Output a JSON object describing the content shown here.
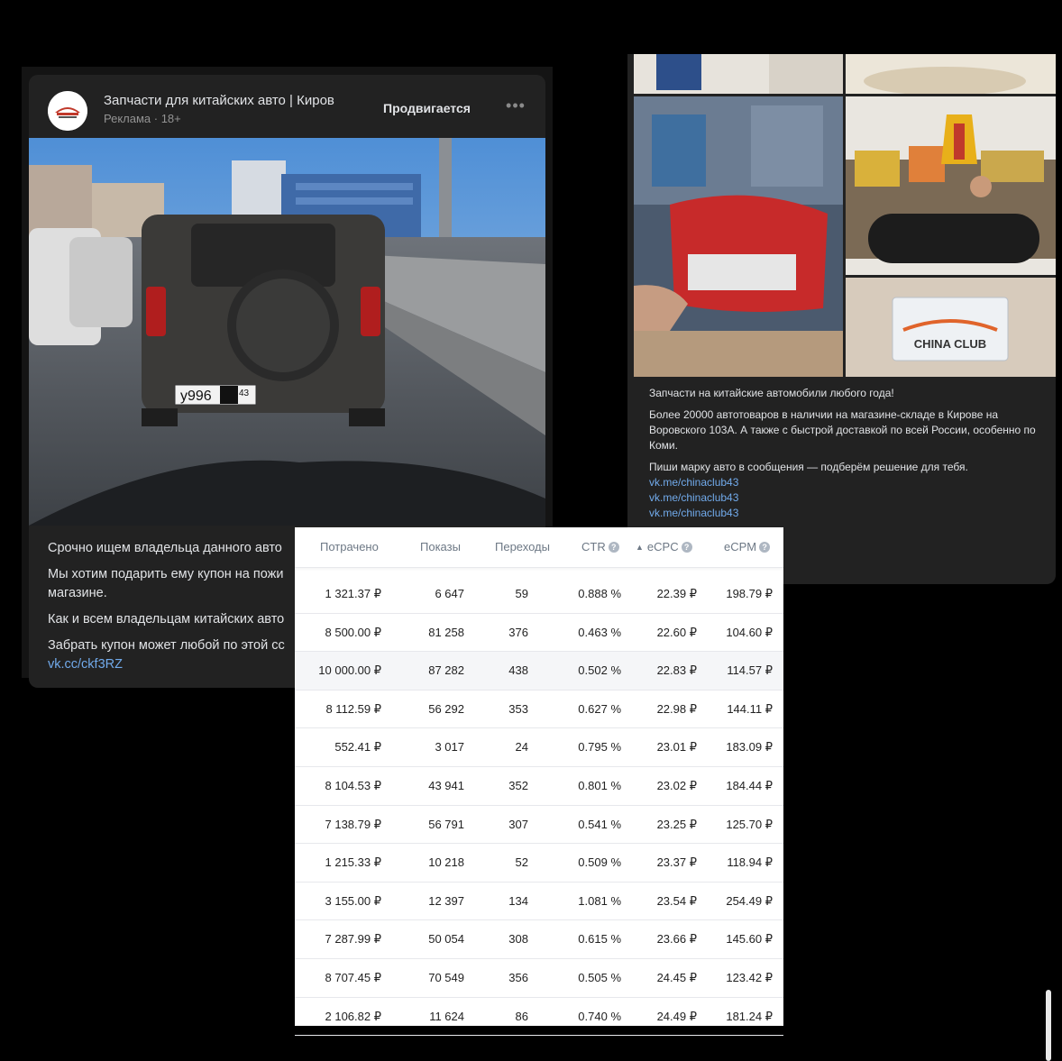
{
  "left_post": {
    "community_name": "Запчасти для китайских авто | Киров",
    "meta": "Реклама · 18+",
    "promo_label": "Продвигается",
    "more": "•••",
    "plate": "у996",
    "plate_region": "43",
    "paragraphs": [
      "Срочно ищем владельца данного авто",
      "Мы хотим подарить ему купон на пожи",
      "магазине.",
      "Как и всем владельцам китайских авто",
      "Забрать купон может любой по этой сс"
    ],
    "link": "vk.cc/ckf3RZ"
  },
  "right_post": {
    "logo_text": "CHINA CLUB",
    "line1": "Запчасти на китайские автомобили любого года!",
    "line2": "Более 20000 автотоваров в наличии на магазине-складе в Кирове на Воровского 103А. А также с быстрой доставкой по всей России, особенно по Коми.",
    "line3": "Пиши марку авто в сообщения — подберём решение для тебя.",
    "links": [
      "vk.me/chinaclub43",
      "vk.me/chinaclub43",
      "vk.me/chinaclub43"
    ]
  },
  "stats": {
    "headers": {
      "spent": "Потрачено",
      "impressions": "Показы",
      "clicks": "Переходы",
      "ctr": "CTR",
      "ecpc": "eCPC",
      "ecpm": "eCPM"
    },
    "help_glyph": "?",
    "sort_glyph": "▲",
    "rows": [
      {
        "spent": "1 321.37 ₽",
        "impressions": "6 647",
        "clicks": "59",
        "ctr": "0.888 %",
        "ecpc": "22.39 ₽",
        "ecpm": "198.79 ₽"
      },
      {
        "spent": "8 500.00 ₽",
        "impressions": "81 258",
        "clicks": "376",
        "ctr": "0.463 %",
        "ecpc": "22.60 ₽",
        "ecpm": "104.60 ₽"
      },
      {
        "spent": "10 000.00 ₽",
        "impressions": "87 282",
        "clicks": "438",
        "ctr": "0.502 %",
        "ecpc": "22.83 ₽",
        "ecpm": "114.57 ₽"
      },
      {
        "spent": "8 112.59 ₽",
        "impressions": "56 292",
        "clicks": "353",
        "ctr": "0.627 %",
        "ecpc": "22.98 ₽",
        "ecpm": "144.11 ₽"
      },
      {
        "spent": "552.41 ₽",
        "impressions": "3 017",
        "clicks": "24",
        "ctr": "0.795 %",
        "ecpc": "23.01 ₽",
        "ecpm": "183.09 ₽"
      },
      {
        "spent": "8 104.53 ₽",
        "impressions": "43 941",
        "clicks": "352",
        "ctr": "0.801 %",
        "ecpc": "23.02 ₽",
        "ecpm": "184.44 ₽"
      },
      {
        "spent": "7 138.79 ₽",
        "impressions": "56 791",
        "clicks": "307",
        "ctr": "0.541 %",
        "ecpc": "23.25 ₽",
        "ecpm": "125.70 ₽"
      },
      {
        "spent": "1 215.33 ₽",
        "impressions": "10 218",
        "clicks": "52",
        "ctr": "0.509 %",
        "ecpc": "23.37 ₽",
        "ecpm": "118.94 ₽"
      },
      {
        "spent": "3 155.00 ₽",
        "impressions": "12 397",
        "clicks": "134",
        "ctr": "1.081 %",
        "ecpc": "23.54 ₽",
        "ecpm": "254.49 ₽"
      },
      {
        "spent": "7 287.99 ₽",
        "impressions": "50 054",
        "clicks": "308",
        "ctr": "0.615 %",
        "ecpc": "23.66 ₽",
        "ecpm": "145.60 ₽"
      },
      {
        "spent": "8 707.45 ₽",
        "impressions": "70 549",
        "clicks": "356",
        "ctr": "0.505 %",
        "ecpc": "24.45 ₽",
        "ecpm": "123.42 ₽"
      },
      {
        "spent": "2 106.82 ₽",
        "impressions": "11 624",
        "clicks": "86",
        "ctr": "0.740 %",
        "ecpc": "24.49 ₽",
        "ecpm": "181.24 ₽"
      }
    ]
  }
}
